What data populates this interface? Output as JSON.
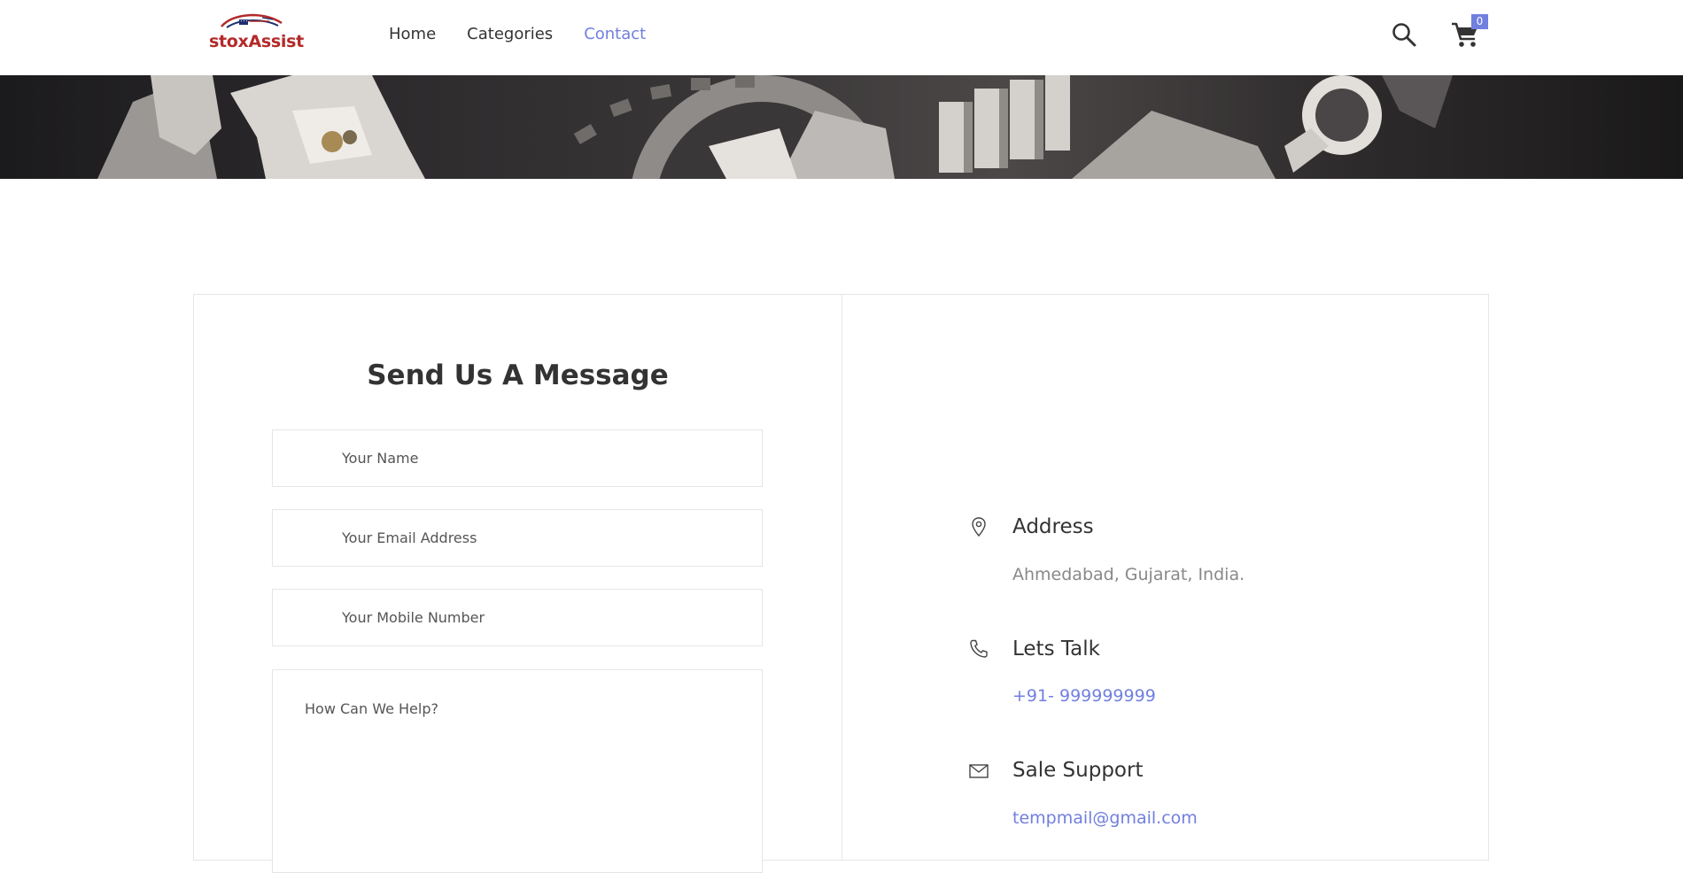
{
  "brand": {
    "name": "stoxAssist",
    "color": "#b32a2a"
  },
  "nav": {
    "items": [
      {
        "label": "Home",
        "active": false
      },
      {
        "label": "Categories",
        "active": false
      },
      {
        "label": "Contact",
        "active": true
      }
    ],
    "accent_color": "#717fe0"
  },
  "header_actions": {
    "search_icon": "search-icon",
    "cart_icon": "cart-icon",
    "cart_count": "0"
  },
  "form": {
    "title": "Send Us A Message",
    "name_placeholder": "Your Name",
    "email_placeholder": "Your Email Address",
    "mobile_placeholder": "Your Mobile Number",
    "message_placeholder": "How Can We Help?"
  },
  "contact_info": {
    "address": {
      "icon": "map-pin-icon",
      "title": "Address",
      "value": "Ahmedabad, Gujarat, India."
    },
    "phone": {
      "icon": "phone-icon",
      "title": "Lets Talk",
      "value": "+91- 999999999"
    },
    "support": {
      "icon": "mail-icon",
      "title": "Sale Support",
      "value": "tempmail@gmail.com"
    }
  }
}
